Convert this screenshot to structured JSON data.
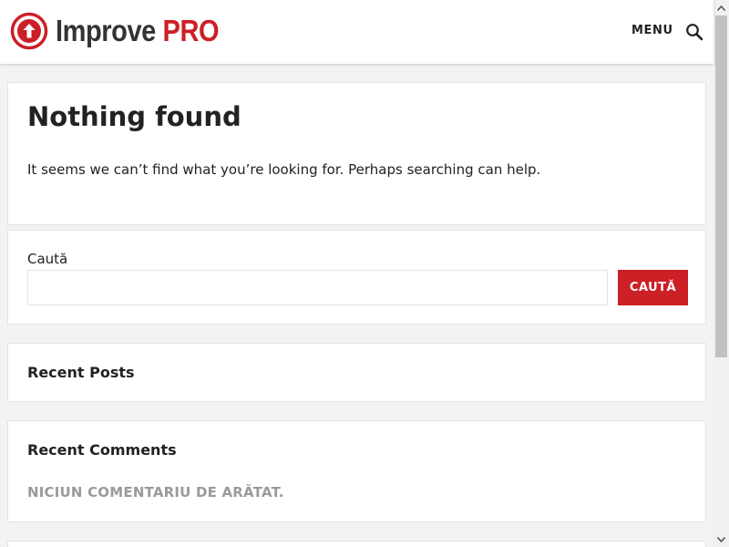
{
  "header": {
    "logo": {
      "part1": "Improve",
      "part2": "PRO"
    },
    "menu_label": "MENU",
    "search_icon": "search-icon"
  },
  "colors": {
    "accent": "#cc1f26",
    "muted": "#9a9a9a"
  },
  "main": {
    "title": "Nothing found",
    "message": "It seems we can’t find what you’re looking for. Perhaps searching can help."
  },
  "search": {
    "label": "Caută",
    "value": "",
    "button_label": "CAUTĂ"
  },
  "recent_posts": {
    "title": "Recent Posts"
  },
  "recent_comments": {
    "title": "Recent Comments",
    "empty_text": "NICIUN COMENTARIU DE ARĂTAT."
  }
}
